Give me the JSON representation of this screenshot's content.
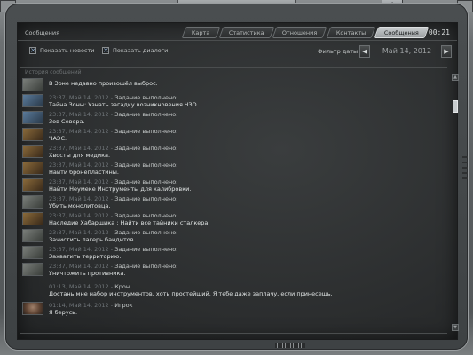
{
  "window": {
    "title": "Сообщения",
    "clock": "00:21",
    "power_icon": "power-icon"
  },
  "tabs": [
    {
      "label": "Карта",
      "active": false
    },
    {
      "label": "Статистика",
      "active": false
    },
    {
      "label": "Отношения",
      "active": false
    },
    {
      "label": "Контакты",
      "active": false
    },
    {
      "label": "Сообщения",
      "active": true
    }
  ],
  "filters": {
    "show_news": {
      "label": "Показать новости",
      "checked": true
    },
    "show_dialogs": {
      "label": "Показать диалоги",
      "checked": true
    },
    "date_filter_label": "Фильтр даты",
    "date_value": "Май 14, 2012"
  },
  "history": {
    "label": "История сообщений",
    "messages": [
      {
        "time": "",
        "sender": "",
        "text": "В Зоне недавно произошёл выброс.",
        "thumb": "gray"
      },
      {
        "time": "23:37, Май 14, 2012",
        "sender": "Задание выполнено:",
        "text": "Тайна Зоны: Узнать загадку возникновения ЧЗО.",
        "thumb": "blue"
      },
      {
        "time": "23:37, Май 14, 2012",
        "sender": "Задание выполнено:",
        "text": "Зов Севера.",
        "thumb": "blue"
      },
      {
        "time": "23:37, Май 14, 2012",
        "sender": "Задание выполнено:",
        "text": "ЧАЭС.",
        "thumb": "brown"
      },
      {
        "time": "23:37, Май 14, 2012",
        "sender": "Задание выполнено:",
        "text": "Хвосты для медика.",
        "thumb": "brown"
      },
      {
        "time": "23:37, Май 14, 2012",
        "sender": "Задание выполнено:",
        "text": "Найти бронепластины.",
        "thumb": "brown"
      },
      {
        "time": "23:37, Май 14, 2012",
        "sender": "Задание выполнено:",
        "text": "Найти Неумеке Инструменты для калибровки.",
        "thumb": "brown"
      },
      {
        "time": "23:37, Май 14, 2012",
        "sender": "Задание выполнено:",
        "text": "Убить монолитовца.",
        "thumb": "gray"
      },
      {
        "time": "23:37, Май 14, 2012",
        "sender": "Задание выполнено:",
        "text": "Наследие Хабарщика : Найти все тайники сталкера.",
        "thumb": "brown"
      },
      {
        "time": "23:37, Май 14, 2012",
        "sender": "Задание выполнено:",
        "text": "Зачистить лагерь бандитов.",
        "thumb": "gray"
      },
      {
        "time": "23:37, Май 14, 2012",
        "sender": "Задание выполнено:",
        "text": "Захватить территорию.",
        "thumb": "gray"
      },
      {
        "time": "23:37, Май 14, 2012",
        "sender": "Задание выполнено:",
        "text": "Уничтожить противника.",
        "thumb": "gray"
      },
      {
        "time": "01:13, Май 14, 2012",
        "sender": "Крон",
        "text": "Достань мне набор инструментов, хоть простейший. Я тебе даже заплачу, если принесешь.",
        "thumb": "none"
      },
      {
        "time": "01:14, Май 14, 2012",
        "sender": "Игрок",
        "text": "Я берусь.",
        "thumb": "face"
      }
    ]
  }
}
